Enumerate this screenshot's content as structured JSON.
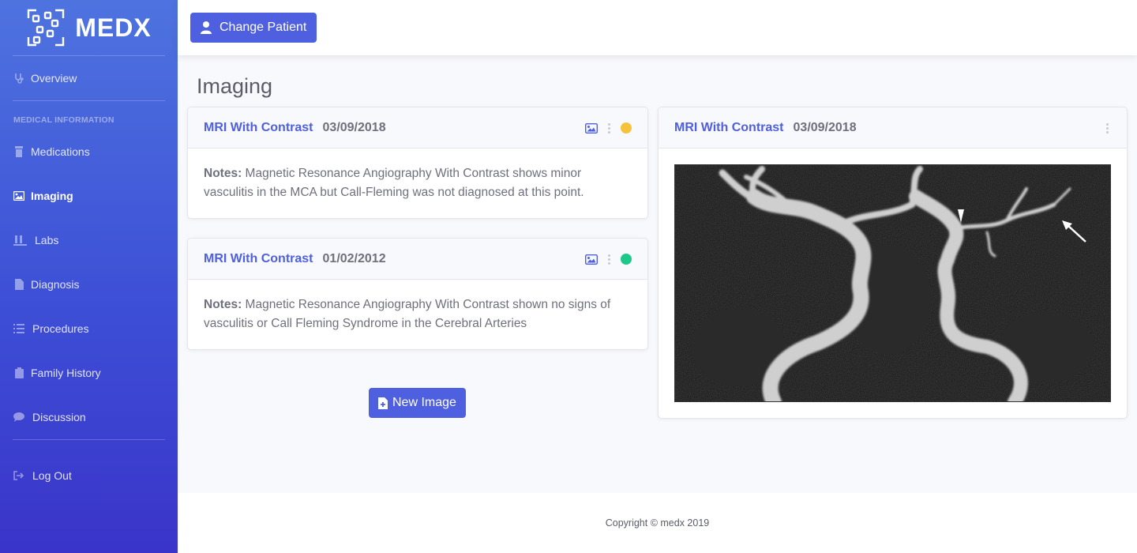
{
  "brand": {
    "name": "MEDX"
  },
  "sidebar": {
    "overview": "Overview",
    "heading": "MEDICAL INFORMATION",
    "items": [
      {
        "label": "Medications",
        "icon": "prescription-bottle-icon"
      },
      {
        "label": "Imaging",
        "icon": "image-icon",
        "active": true
      },
      {
        "label": "Labs",
        "icon": "vials-icon"
      },
      {
        "label": "Diagnosis",
        "icon": "file-icon"
      },
      {
        "label": "Procedures",
        "icon": "list-icon"
      },
      {
        "label": "Family History",
        "icon": "clipboard-icon"
      },
      {
        "label": "Discussion",
        "icon": "comment-icon"
      }
    ],
    "logout": "Log Out"
  },
  "topbar": {
    "change_patient": "Change Patient"
  },
  "page": {
    "title": "Imaging"
  },
  "records": [
    {
      "title": "MRI With Contrast",
      "date": "03/09/2018",
      "notes_label": "Notes:",
      "notes": "Magnetic Resonance Angiography With Contrast shows minor vasculitis in the MCA but Call-Fleming was not diagnosed at this point.",
      "status_color": "#f6c23e"
    },
    {
      "title": "MRI With Contrast",
      "date": "01/02/2012",
      "notes_label": "Notes:",
      "notes": "Magnetic Resonance Angiography With Contrast shown no signs of vasculitis or Call Fleming Syndrome in the Cerebral Arteries",
      "status_color": "#1cc88a"
    }
  ],
  "new_image_button": "New Image",
  "viewer": {
    "title": "MRI With Contrast",
    "date": "03/09/2018"
  },
  "footer": {
    "copyright": "Copyright © medx 2019"
  },
  "colors": {
    "primary": "#4e5fe0",
    "sidebar_top": "#4e73df",
    "sidebar_bottom": "#3a34c9"
  }
}
